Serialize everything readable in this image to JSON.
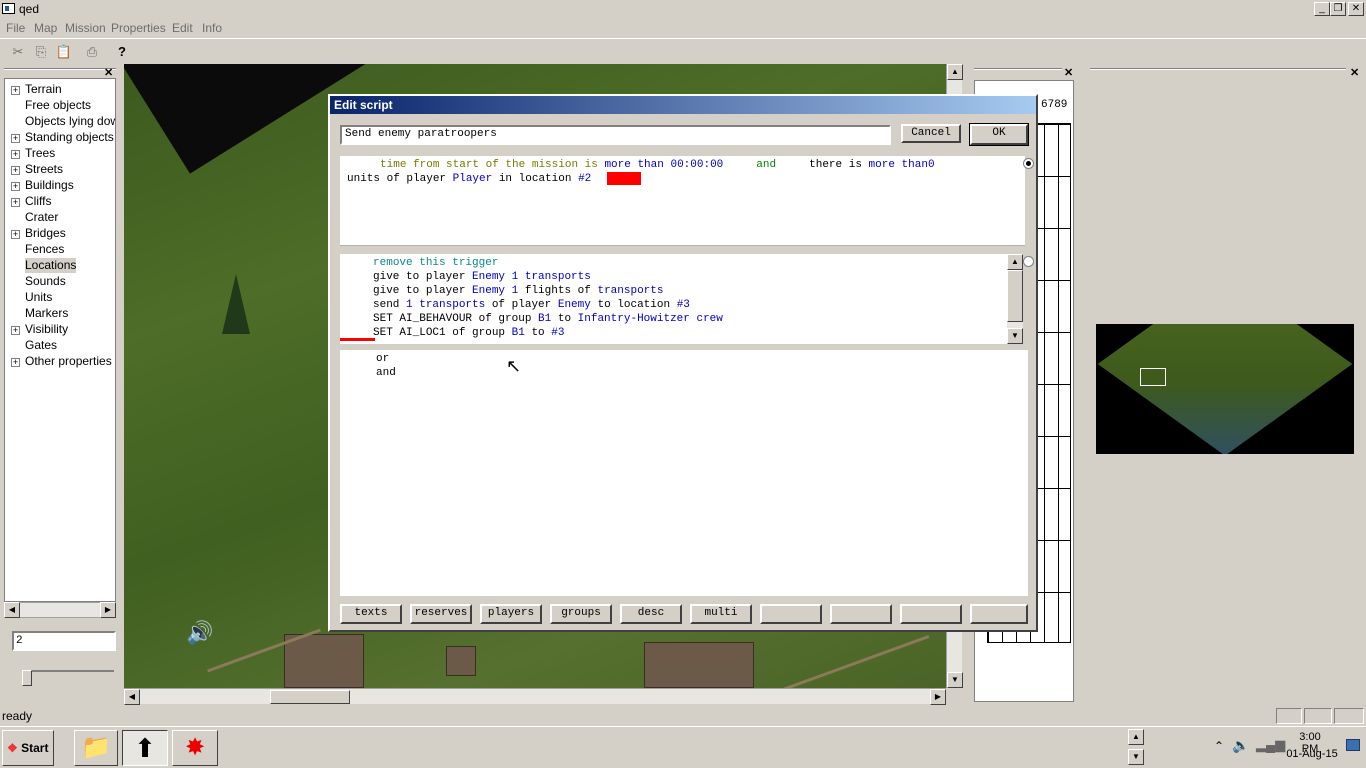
{
  "window": {
    "title": "qed"
  },
  "menu": [
    "File",
    "Map",
    "Mission",
    "Properties",
    "Edit",
    "Info"
  ],
  "toolbar": {
    "help_icon": "?"
  },
  "tree": [
    {
      "label": "Terrain",
      "expandable": true
    },
    {
      "label": "Free objects",
      "expandable": false
    },
    {
      "label": "Objects lying down",
      "expandable": false
    },
    {
      "label": "Standing objects",
      "expandable": true
    },
    {
      "label": "Trees",
      "expandable": true
    },
    {
      "label": "Streets",
      "expandable": true
    },
    {
      "label": "Buildings",
      "expandable": true
    },
    {
      "label": "Cliffs",
      "expandable": true
    },
    {
      "label": "Crater",
      "expandable": false
    },
    {
      "label": "Bridges",
      "expandable": true
    },
    {
      "label": "Fences",
      "expandable": false
    },
    {
      "label": "Locations",
      "expandable": false,
      "selected": true
    },
    {
      "label": "Sounds",
      "expandable": false
    },
    {
      "label": "Units",
      "expandable": false
    },
    {
      "label": "Markers",
      "expandable": false
    },
    {
      "label": "Visibility",
      "expandable": true
    },
    {
      "label": "Gates",
      "expandable": false
    },
    {
      "label": "Other properties",
      "expandable": true
    }
  ],
  "spinner": {
    "value": "2"
  },
  "dialog": {
    "title": "Edit script",
    "name_value": "Send enemy paratroopers",
    "cancel_label": "Cancel",
    "ok_label": "OK",
    "right_digits": "6789",
    "condition": {
      "line1": [
        {
          "t": "     ",
          "c": ""
        },
        {
          "t": "time from start of the mission is ",
          "c": "olive"
        },
        {
          "t": "more than 00:00:00",
          "c": "blue"
        },
        {
          "t": "     ",
          "c": ""
        },
        {
          "t": "and",
          "c": "green"
        },
        {
          "t": "     there is ",
          "c": ""
        },
        {
          "t": "more than0",
          "c": "blue"
        }
      ],
      "line2": [
        {
          "t": "units of player ",
          "c": ""
        },
        {
          "t": "Player",
          "c": "blue"
        },
        {
          "t": " in location ",
          "c": ""
        },
        {
          "t": "#2",
          "c": "blue"
        }
      ]
    },
    "actions": [
      [
        {
          "t": "     ",
          "c": ""
        },
        {
          "t": "remove this trigger",
          "c": "teal"
        }
      ],
      [
        {
          "t": "     give to player ",
          "c": ""
        },
        {
          "t": "Enemy 1 transports",
          "c": "blue"
        }
      ],
      [
        {
          "t": "     give to player ",
          "c": ""
        },
        {
          "t": "Enemy 1",
          "c": "blue"
        },
        {
          "t": " flights of ",
          "c": ""
        },
        {
          "t": "transports",
          "c": "blue"
        }
      ],
      [
        {
          "t": "     send ",
          "c": ""
        },
        {
          "t": "1 transports",
          "c": "blue"
        },
        {
          "t": " of player ",
          "c": ""
        },
        {
          "t": "Enemy",
          "c": "blue"
        },
        {
          "t": " to location ",
          "c": ""
        },
        {
          "t": "#3",
          "c": "blue"
        }
      ],
      [
        {
          "t": "     SET AI_BEHAVOUR of group ",
          "c": ""
        },
        {
          "t": "B1",
          "c": "blue"
        },
        {
          "t": " to ",
          "c": ""
        },
        {
          "t": "Infantry-Howitzer crew",
          "c": "blue"
        }
      ],
      [
        {
          "t": "     SET AI_LOC1 of group ",
          "c": ""
        },
        {
          "t": "B1",
          "c": "blue"
        },
        {
          "t": " to ",
          "c": ""
        },
        {
          "t": "#3",
          "c": "blue"
        }
      ]
    ],
    "options": [
      "or",
      "and"
    ],
    "bottom_buttons": [
      "texts",
      "reserves",
      "players",
      "groups",
      "desc",
      "multi",
      "",
      "",
      "",
      ""
    ]
  },
  "status": {
    "text": "ready"
  },
  "taskbar": {
    "start_label": "Start",
    "time": "3:00 PM",
    "date": "01-Aug-15"
  },
  "colors": {
    "title_gradient_start": "#0a246a",
    "title_gradient_end": "#a6caf0",
    "highlight_red": "#ff0000"
  }
}
